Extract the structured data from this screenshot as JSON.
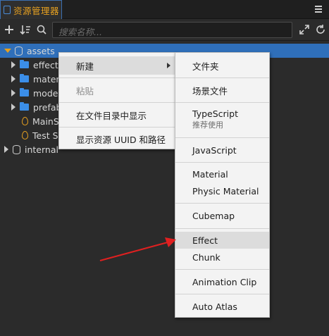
{
  "panel": {
    "tab_title": "资源管理器",
    "search_placeholder": "搜索名称..."
  },
  "colors": {
    "tab_title": "#e6a020",
    "selection": "#2f6fba",
    "folder": "#3b8ee8",
    "annotation_arrow": "#e02020"
  },
  "toolbar": {
    "icons": [
      "plus-icon",
      "sort-icon",
      "search-icon",
      "expand-icon",
      "refresh-icon"
    ]
  },
  "tree": {
    "items": [
      {
        "label": "assets"
      },
      {
        "label": "effect"
      },
      {
        "label": "materi"
      },
      {
        "label": "model"
      },
      {
        "label": "prefab"
      },
      {
        "label": "MainSc"
      },
      {
        "label": "Test Sc"
      },
      {
        "label": "internal"
      }
    ]
  },
  "context_menu": {
    "items": [
      {
        "label": "新建"
      },
      {
        "label": "粘贴"
      },
      {
        "label": "在文件目录中显示"
      },
      {
        "label": "显示资源 UUID 和路径"
      }
    ]
  },
  "submenu": {
    "items": [
      {
        "label": "文件夹"
      },
      {
        "label": "场景文件"
      },
      {
        "label": "TypeScript",
        "sub": "推荐使用"
      },
      {
        "label": "JavaScript"
      },
      {
        "label": "Material"
      },
      {
        "label": "Physic Material"
      },
      {
        "label": "Cubemap"
      },
      {
        "label": "Effect"
      },
      {
        "label": "Chunk"
      },
      {
        "label": "Animation Clip"
      },
      {
        "label": "Auto Atlas"
      }
    ]
  }
}
